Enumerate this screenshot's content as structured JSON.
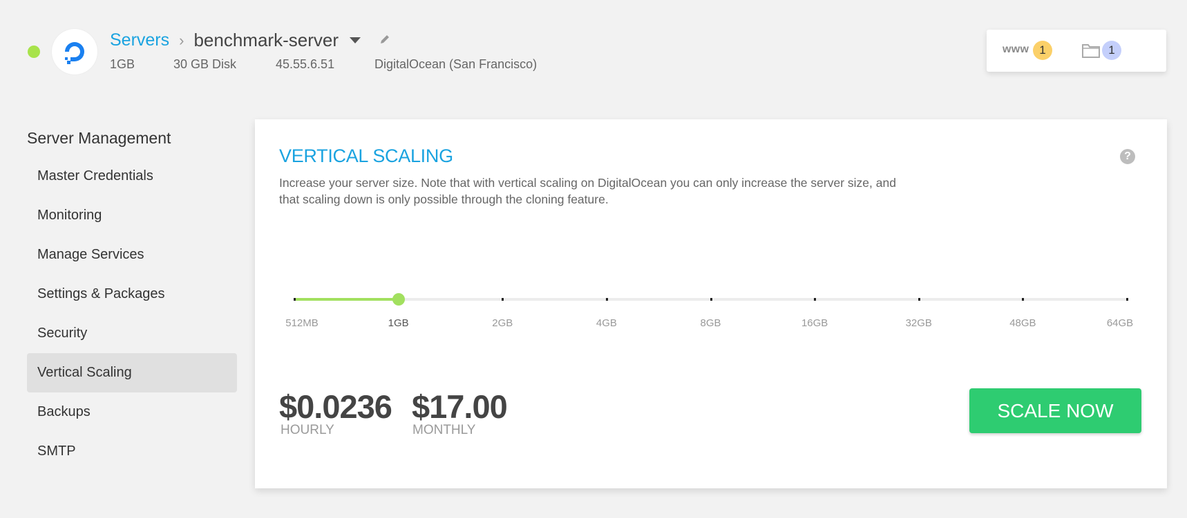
{
  "header": {
    "status_color": "#a8e34b",
    "logo_icon": "digitalocean-logo-icon",
    "breadcrumb": {
      "parent": "Servers",
      "separator": "›",
      "current": "benchmark-server"
    },
    "meta": {
      "ram": "1GB",
      "disk": "30 GB Disk",
      "ip": "45.55.6.51",
      "provider": "DigitalOcean (San Francisco)"
    },
    "counters": {
      "www_label": "www",
      "www_count": "1",
      "folder_count": "1"
    }
  },
  "sidebar": {
    "title": "Server Management",
    "items": [
      {
        "label": "Master Credentials",
        "active": false
      },
      {
        "label": "Monitoring",
        "active": false
      },
      {
        "label": "Manage Services",
        "active": false
      },
      {
        "label": "Settings & Packages",
        "active": false
      },
      {
        "label": "Security",
        "active": false
      },
      {
        "label": "Vertical Scaling",
        "active": true
      },
      {
        "label": "Backups",
        "active": false
      },
      {
        "label": "SMTP",
        "active": false
      }
    ]
  },
  "main": {
    "title": "VERTICAL SCALING",
    "help_icon": "?",
    "description": "Increase your server size. Note that with vertical scaling on DigitalOcean you can only increase the server size, and that scaling down is only possible through the cloning feature.",
    "slider": {
      "options": [
        "512MB",
        "1GB",
        "2GB",
        "4GB",
        "8GB",
        "16GB",
        "32GB",
        "48GB",
        "64GB"
      ],
      "selected_index": 1,
      "accent": "#a2e05f"
    },
    "pricing": {
      "hourly_value": "$0.0236",
      "hourly_label": "HOURLY",
      "monthly_value": "$17.00",
      "monthly_label": "MONTHLY"
    },
    "scale_button": "SCALE NOW",
    "button_color": "#2ecc71"
  }
}
